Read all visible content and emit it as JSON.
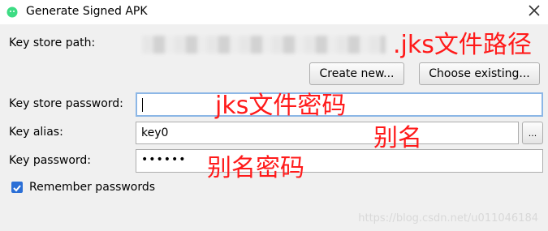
{
  "window": {
    "title": "Generate Signed APK"
  },
  "form": {
    "keystore_path_label": "Key store path:",
    "create_new_label": "Create new...",
    "choose_existing_label": "Choose existing...",
    "keystore_password_label": "Key store password:",
    "key_alias_label": "Key alias:",
    "key_alias_value": "key0",
    "browse_label": "...",
    "key_password_label": "Key password:",
    "key_password_mask": "••••••",
    "remember_label": "Remember passwords"
  },
  "annotations": {
    "path_note": ".jks文件路径",
    "password_note": "jks文件密码",
    "alias_note": "别名",
    "alias_password_note": "别名密码"
  },
  "watermark": "https://blog.csdn.net/u011046184"
}
